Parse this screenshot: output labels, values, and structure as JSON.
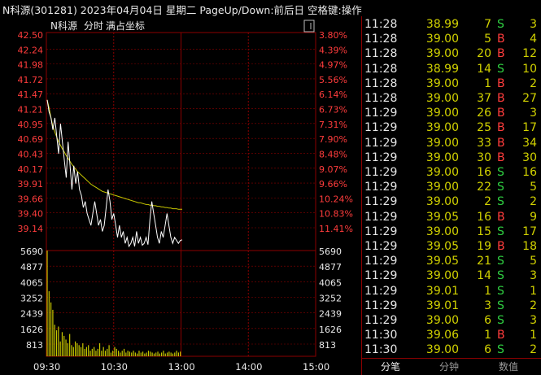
{
  "title": "N科源(301281) 2023年04月04日 星期二 PageUp/Down:前后日 空格键:操作",
  "chart_header": {
    "stock": "N科源",
    "mode": "分时",
    "coord": "满占坐标"
  },
  "colors": {
    "up": "#ff3c3c",
    "down": "#2ecc40",
    "price_line": "#ffffff",
    "avg_line": "#c8c800",
    "volume": "#c8c800",
    "grid": "#8b0000"
  },
  "chart_data": {
    "type": "line",
    "price_ylim": [
      38.88,
      42.5
    ],
    "price_ticks": [
      "42.50",
      "42.24",
      "41.98",
      "41.72",
      "41.47",
      "41.21",
      "40.95",
      "40.69",
      "40.43",
      "40.17",
      "39.91",
      "39.66",
      "39.40",
      "39.14"
    ],
    "pct_ticks": [
      "3.80%",
      "4.39%",
      "4.97%",
      "5.56%",
      "6.14%",
      "6.73%",
      "7.31%",
      "7.90%",
      "8.48%",
      "9.07%",
      "9.66%",
      "10.24%",
      "10.83%",
      "11.41%"
    ],
    "volume_ticks": [
      "5690",
      "4877",
      "4065",
      "3252",
      "2439",
      "1626",
      "813"
    ],
    "x_ticks": [
      "09:30",
      "10:30",
      "13:00",
      "14:00",
      "15:00"
    ],
    "price": [
      41.4,
      41.2,
      41.1,
      40.9,
      41.1,
      40.8,
      40.5,
      41.0,
      40.7,
      40.4,
      40.1,
      40.7,
      40.3,
      39.9,
      40.3,
      40.0,
      40.2,
      39.9,
      39.8,
      39.6,
      39.7,
      39.5,
      39.4,
      39.3,
      39.5,
      39.7,
      39.5,
      39.3,
      39.4,
      39.2,
      39.3,
      39.6,
      39.9,
      39.7,
      39.4,
      39.5,
      39.3,
      39.1,
      39.3,
      39.1,
      39.2,
      39.0,
      39.1,
      38.95,
      39.0,
      39.1,
      38.95,
      39.2,
      39.0,
      39.1,
      38.97,
      39.0,
      39.1,
      38.98,
      39.4,
      39.7,
      39.5,
      39.3,
      39.1,
      39.0,
      39.2,
      39.1,
      39.3,
      39.5,
      39.3,
      39.1,
      39.0,
      39.1,
      39.05,
      39.0,
      39.05,
      39.06
    ],
    "avg": [
      41.4,
      41.27,
      41.1,
      40.96,
      40.86,
      40.78,
      40.7,
      40.64,
      40.58,
      40.53,
      40.47,
      40.42,
      40.37,
      40.32,
      40.28,
      40.24,
      40.2,
      40.17,
      40.14,
      40.11,
      40.08,
      40.05,
      40.02,
      39.99,
      39.97,
      39.95,
      39.93,
      39.91,
      39.89,
      39.87,
      39.86,
      39.85,
      39.84,
      39.83,
      39.82,
      39.81,
      39.8,
      39.79,
      39.78,
      39.77,
      39.76,
      39.75,
      39.74,
      39.73,
      39.72,
      39.71,
      39.7,
      39.69,
      39.68,
      39.68,
      39.67,
      39.66,
      39.65,
      39.65,
      39.64,
      39.64,
      39.63,
      39.63,
      39.62,
      39.62,
      39.61,
      39.61,
      39.6,
      39.6,
      39.59,
      39.59,
      39.58,
      39.58,
      39.58,
      39.57,
      39.57,
      39.57
    ],
    "volume_ylim": [
      0,
      5690
    ],
    "volume": [
      5690,
      3500,
      2900,
      2500,
      1700,
      1400,
      1600,
      800,
      1300,
      1100,
      900,
      700,
      1200,
      600,
      500,
      800,
      700,
      600,
      500,
      700,
      400,
      500,
      600,
      300,
      400,
      500,
      300,
      400,
      700,
      300,
      500,
      300,
      400,
      600,
      200,
      300,
      500,
      400,
      300,
      200,
      300,
      400,
      200,
      300,
      250,
      200,
      300,
      200,
      150,
      300,
      200,
      250,
      150,
      200,
      300,
      250,
      200,
      150,
      200,
      250,
      150,
      200,
      300,
      150,
      200,
      250,
      200,
      150,
      200,
      300,
      200,
      250
    ]
  },
  "trades": [
    {
      "time": "11:28",
      "price": "38.99",
      "vol": "7",
      "bs": "S",
      "cnt": "3"
    },
    {
      "time": "11:28",
      "price": "39.00",
      "vol": "5",
      "bs": "B",
      "cnt": "4"
    },
    {
      "time": "11:28",
      "price": "39.00",
      "vol": "20",
      "bs": "B",
      "cnt": "12"
    },
    {
      "time": "11:28",
      "price": "38.99",
      "vol": "14",
      "bs": "S",
      "cnt": "10"
    },
    {
      "time": "11:28",
      "price": "39.00",
      "vol": "1",
      "bs": "B",
      "cnt": "2"
    },
    {
      "time": "11:28",
      "price": "39.00",
      "vol": "37",
      "bs": "B",
      "cnt": "27"
    },
    {
      "time": "11:29",
      "price": "39.00",
      "vol": "26",
      "bs": "B",
      "cnt": "3"
    },
    {
      "time": "11:29",
      "price": "39.00",
      "vol": "25",
      "bs": "B",
      "cnt": "17"
    },
    {
      "time": "11:29",
      "price": "39.00",
      "vol": "33",
      "bs": "B",
      "cnt": "34"
    },
    {
      "time": "11:29",
      "price": "39.00",
      "vol": "30",
      "bs": "B",
      "cnt": "30"
    },
    {
      "time": "11:29",
      "price": "39.00",
      "vol": "16",
      "bs": "S",
      "cnt": "16"
    },
    {
      "time": "11:29",
      "price": "39.00",
      "vol": "22",
      "bs": "S",
      "cnt": "5"
    },
    {
      "time": "11:29",
      "price": "39.00",
      "vol": "2",
      "bs": "S",
      "cnt": "2"
    },
    {
      "time": "11:29",
      "price": "39.05",
      "vol": "16",
      "bs": "B",
      "cnt": "9"
    },
    {
      "time": "11:29",
      "price": "39.00",
      "vol": "15",
      "bs": "S",
      "cnt": "17"
    },
    {
      "time": "11:29",
      "price": "39.05",
      "vol": "19",
      "bs": "B",
      "cnt": "18"
    },
    {
      "time": "11:29",
      "price": "39.05",
      "vol": "21",
      "bs": "S",
      "cnt": "5"
    },
    {
      "time": "11:29",
      "price": "39.00",
      "vol": "14",
      "bs": "S",
      "cnt": "3"
    },
    {
      "time": "11:29",
      "price": "39.01",
      "vol": "1",
      "bs": "S",
      "cnt": "1"
    },
    {
      "time": "11:29",
      "price": "39.01",
      "vol": "3",
      "bs": "S",
      "cnt": "2"
    },
    {
      "time": "11:29",
      "price": "39.00",
      "vol": "6",
      "bs": "S",
      "cnt": "3"
    },
    {
      "time": "11:30",
      "price": "39.06",
      "vol": "1",
      "bs": "B",
      "cnt": "1"
    },
    {
      "time": "11:30",
      "price": "39.00",
      "vol": "6",
      "bs": "S",
      "cnt": "2"
    }
  ],
  "tabs": [
    "分笔",
    "分钟",
    "数值"
  ],
  "button_icon": "window-toggle-icon"
}
